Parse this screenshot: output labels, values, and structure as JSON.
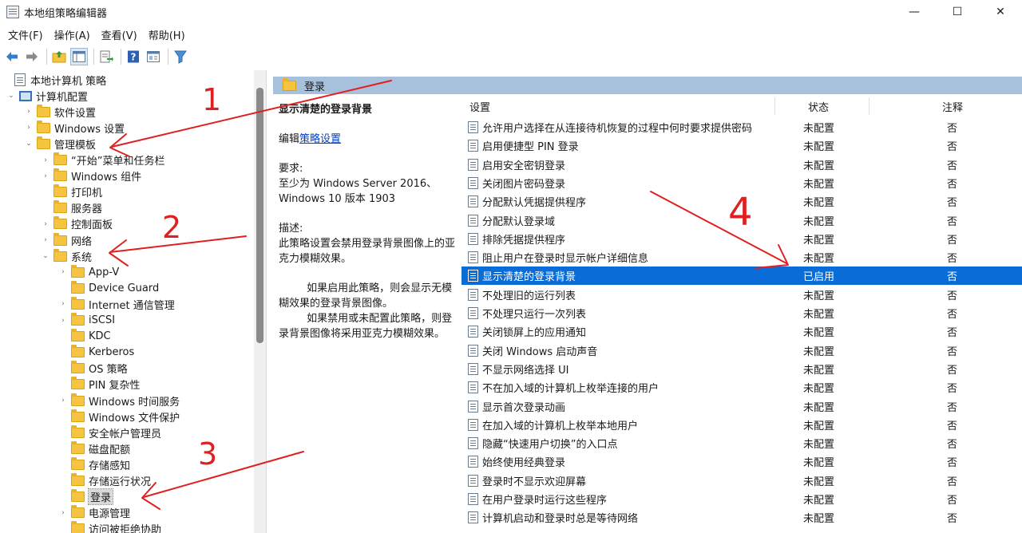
{
  "window": {
    "title": "本地组策略编辑器",
    "controls": {
      "minimize": "—",
      "maximize": "☐",
      "close": "✕"
    }
  },
  "menu": [
    "文件(F)",
    "操作(A)",
    "查看(V)",
    "帮助(H)"
  ],
  "toolbar": {
    "icons": [
      "back-arrow-icon",
      "forward-arrow-icon",
      "up-folder-icon",
      "show-tree-icon",
      "export-list-icon",
      "help-icon",
      "properties-icon",
      "filter-icon"
    ]
  },
  "tree": {
    "items": [
      {
        "label": "本地计算机 策略",
        "icon": "policy",
        "twisty": "",
        "indent": 0
      },
      {
        "label": "计算机配置",
        "icon": "computer",
        "twisty": "⌄",
        "indent": 1
      },
      {
        "label": "软件设置",
        "icon": "folder",
        "twisty": "›",
        "indent": 2
      },
      {
        "label": "Windows 设置",
        "icon": "folder",
        "twisty": "›",
        "indent": 2
      },
      {
        "label": "管理模板",
        "icon": "folder",
        "twisty": "⌄",
        "indent": 2
      },
      {
        "label": "“开始”菜单和任务栏",
        "icon": "folder",
        "twisty": "›",
        "indent": 3
      },
      {
        "label": "Windows 组件",
        "icon": "folder",
        "twisty": "›",
        "indent": 3
      },
      {
        "label": "打印机",
        "icon": "folder",
        "twisty": "",
        "indent": 3
      },
      {
        "label": "服务器",
        "icon": "folder",
        "twisty": "",
        "indent": 3
      },
      {
        "label": "控制面板",
        "icon": "folder",
        "twisty": "›",
        "indent": 3
      },
      {
        "label": "网络",
        "icon": "folder",
        "twisty": "›",
        "indent": 3
      },
      {
        "label": "系统",
        "icon": "folder",
        "twisty": "⌄",
        "indent": 3
      },
      {
        "label": "App-V",
        "icon": "folder",
        "twisty": "›",
        "indent": 4
      },
      {
        "label": "Device Guard",
        "icon": "folder",
        "twisty": "",
        "indent": 4
      },
      {
        "label": "Internet 通信管理",
        "icon": "folder",
        "twisty": "›",
        "indent": 4
      },
      {
        "label": "iSCSI",
        "icon": "folder",
        "twisty": "›",
        "indent": 4
      },
      {
        "label": "KDC",
        "icon": "folder",
        "twisty": "",
        "indent": 4
      },
      {
        "label": "Kerberos",
        "icon": "folder",
        "twisty": "",
        "indent": 4
      },
      {
        "label": "OS 策略",
        "icon": "folder",
        "twisty": "",
        "indent": 4
      },
      {
        "label": "PIN 复杂性",
        "icon": "folder",
        "twisty": "",
        "indent": 4
      },
      {
        "label": "Windows 时间服务",
        "icon": "folder",
        "twisty": "›",
        "indent": 4
      },
      {
        "label": "Windows 文件保护",
        "icon": "folder",
        "twisty": "",
        "indent": 4
      },
      {
        "label": "安全帐户管理员",
        "icon": "folder",
        "twisty": "",
        "indent": 4
      },
      {
        "label": "磁盘配额",
        "icon": "folder",
        "twisty": "",
        "indent": 4
      },
      {
        "label": "存储感知",
        "icon": "folder",
        "twisty": "",
        "indent": 4
      },
      {
        "label": "存储运行状况",
        "icon": "folder",
        "twisty": "",
        "indent": 4
      },
      {
        "label": "登录",
        "icon": "folder",
        "twisty": "",
        "indent": 4,
        "selected": true
      },
      {
        "label": "电源管理",
        "icon": "folder",
        "twisty": "›",
        "indent": 4
      },
      {
        "label": "访问被拒绝协助",
        "icon": "folder",
        "twisty": "",
        "indent": 4
      }
    ]
  },
  "right_header": {
    "title": "登录"
  },
  "description": {
    "title": "显示清楚的登录背景",
    "edit_prefix": "编辑",
    "edit_link": "策略设置",
    "requirements_label": "要求:",
    "requirements_text": "至少为 Windows Server 2016、Windows 10 版本 1903",
    "description_label": "描述:",
    "description_text": "此策略设置会禁用登录背景图像上的亚克力模糊效果。",
    "para1": "如果启用此策略，则会显示无模糊效果的登录背景图像。",
    "para2": "如果禁用或未配置此策略，则登录背景图像将采用亚克力模糊效果。"
  },
  "list": {
    "columns": {
      "setting": "设置",
      "state": "状态",
      "comment": "注释"
    },
    "rows": [
      {
        "name": "允许用户选择在从连接待机恢复的过程中何时要求提供密码",
        "state": "未配置",
        "comment": "否"
      },
      {
        "name": "启用便捷型 PIN 登录",
        "state": "未配置",
        "comment": "否"
      },
      {
        "name": "启用安全密钥登录",
        "state": "未配置",
        "comment": "否"
      },
      {
        "name": "关闭图片密码登录",
        "state": "未配置",
        "comment": "否"
      },
      {
        "name": "分配默认凭据提供程序",
        "state": "未配置",
        "comment": "否"
      },
      {
        "name": "分配默认登录域",
        "state": "未配置",
        "comment": "否"
      },
      {
        "name": "排除凭据提供程序",
        "state": "未配置",
        "comment": "否"
      },
      {
        "name": "阻止用户在登录时显示帐户详细信息",
        "state": "未配置",
        "comment": "否"
      },
      {
        "name": "显示清楚的登录背景",
        "state": "已启用",
        "comment": "否",
        "selected": true
      },
      {
        "name": "不处理旧的运行列表",
        "state": "未配置",
        "comment": "否"
      },
      {
        "name": "不处理只运行一次列表",
        "state": "未配置",
        "comment": "否"
      },
      {
        "name": "关闭锁屏上的应用通知",
        "state": "未配置",
        "comment": "否"
      },
      {
        "name": "关闭 Windows 启动声音",
        "state": "未配置",
        "comment": "否"
      },
      {
        "name": "不显示网络选择 UI",
        "state": "未配置",
        "comment": "否"
      },
      {
        "name": "不在加入域的计算机上枚举连接的用户",
        "state": "未配置",
        "comment": "否"
      },
      {
        "name": "显示首次登录动画",
        "state": "未配置",
        "comment": "否"
      },
      {
        "name": "在加入域的计算机上枚举本地用户",
        "state": "未配置",
        "comment": "否"
      },
      {
        "name": "隐藏“快速用户切换”的入口点",
        "state": "未配置",
        "comment": "否"
      },
      {
        "name": "始终使用经典登录",
        "state": "未配置",
        "comment": "否"
      },
      {
        "name": "登录时不显示欢迎屏幕",
        "state": "未配置",
        "comment": "否"
      },
      {
        "name": "在用户登录时运行这些程序",
        "state": "未配置",
        "comment": "否"
      },
      {
        "name": "计算机启动和登录时总是等待网络",
        "state": "未配置",
        "comment": "否"
      }
    ]
  },
  "annotations": {
    "labels": [
      "1",
      "2",
      "3",
      "4"
    ],
    "color": "#e02020"
  },
  "colors": {
    "selection": "#0a6cd6",
    "header_bar": "#a7c0dc",
    "link": "#0044cc"
  }
}
